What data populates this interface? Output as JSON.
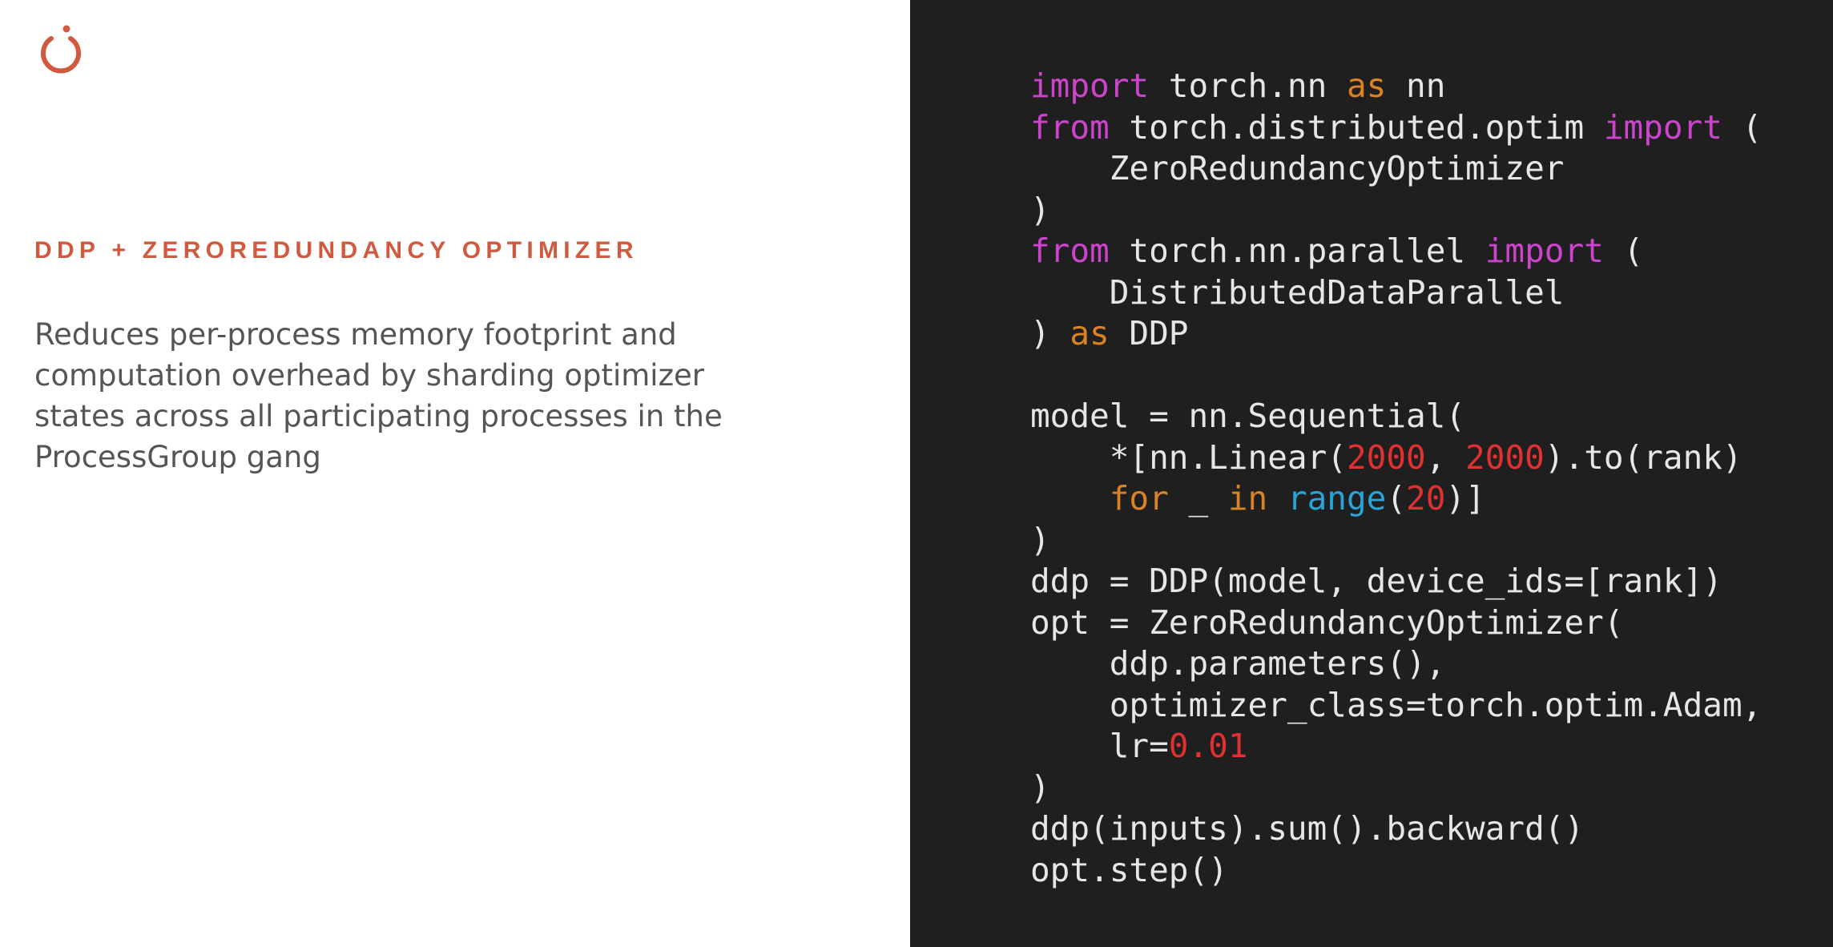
{
  "slide": {
    "heading": "DDP + ZEROREDUNDANCY OPTIMIZER",
    "body_lines": [
      "Reduces per-process memory footprint and",
      "computation overhead by sharding optimizer",
      "states across all participating processes in the",
      "ProcessGroup gang"
    ],
    "logo_icon": "pytorch-logo-icon",
    "colors": {
      "accent": "#d05a3f",
      "code_background": "#1f1f1f",
      "keyword_magenta": "#cc44cc",
      "keyword_orange": "#d98324",
      "builtin_blue": "#2aa4d6",
      "number_red": "#e03030"
    }
  },
  "code": {
    "lines": [
      [
        {
          "t": "import",
          "c": "kw-m"
        },
        {
          "t": " torch.nn ",
          "c": "plain"
        },
        {
          "t": "as",
          "c": "kw-o"
        },
        {
          "t": " nn",
          "c": "plain"
        }
      ],
      [
        {
          "t": "from",
          "c": "kw-m"
        },
        {
          "t": " torch.distributed.optim ",
          "c": "plain"
        },
        {
          "t": "import",
          "c": "kw-m"
        },
        {
          "t": " (",
          "c": "plain"
        }
      ],
      [
        {
          "t": "    ZeroRedundancyOptimizer",
          "c": "plain"
        }
      ],
      [
        {
          "t": ")",
          "c": "plain"
        }
      ],
      [
        {
          "t": "from",
          "c": "kw-m"
        },
        {
          "t": " torch.nn.parallel ",
          "c": "plain"
        },
        {
          "t": "import",
          "c": "kw-m"
        },
        {
          "t": " (",
          "c": "plain"
        }
      ],
      [
        {
          "t": "    DistributedDataParallel",
          "c": "plain"
        }
      ],
      [
        {
          "t": ") ",
          "c": "plain"
        },
        {
          "t": "as",
          "c": "kw-o"
        },
        {
          "t": " DDP",
          "c": "plain"
        }
      ],
      [
        {
          "t": "",
          "c": "plain"
        }
      ],
      [
        {
          "t": "model = nn.Sequential(",
          "c": "plain"
        }
      ],
      [
        {
          "t": "    *[nn.Linear(",
          "c": "plain"
        },
        {
          "t": "2000",
          "c": "num"
        },
        {
          "t": ", ",
          "c": "plain"
        },
        {
          "t": "2000",
          "c": "num"
        },
        {
          "t": ").to(rank)",
          "c": "plain"
        }
      ],
      [
        {
          "t": "    ",
          "c": "plain"
        },
        {
          "t": "for",
          "c": "kw-o"
        },
        {
          "t": " _ ",
          "c": "plain"
        },
        {
          "t": "in",
          "c": "kw-o"
        },
        {
          "t": " ",
          "c": "plain"
        },
        {
          "t": "range",
          "c": "fn-b"
        },
        {
          "t": "(",
          "c": "plain"
        },
        {
          "t": "20",
          "c": "num"
        },
        {
          "t": ")]",
          "c": "plain"
        }
      ],
      [
        {
          "t": ")",
          "c": "plain"
        }
      ],
      [
        {
          "t": "ddp = DDP(model, device_ids=[rank])",
          "c": "plain"
        }
      ],
      [
        {
          "t": "opt = ZeroRedundancyOptimizer(",
          "c": "plain"
        }
      ],
      [
        {
          "t": "    ddp.parameters(),",
          "c": "plain"
        }
      ],
      [
        {
          "t": "    optimizer_class=torch.optim.Adam,",
          "c": "plain"
        }
      ],
      [
        {
          "t": "    lr=",
          "c": "plain"
        },
        {
          "t": "0.01",
          "c": "num"
        }
      ],
      [
        {
          "t": ")",
          "c": "plain"
        }
      ],
      [
        {
          "t": "ddp(inputs).sum().backward()",
          "c": "plain"
        }
      ],
      [
        {
          "t": "opt.step()",
          "c": "plain"
        }
      ]
    ]
  }
}
